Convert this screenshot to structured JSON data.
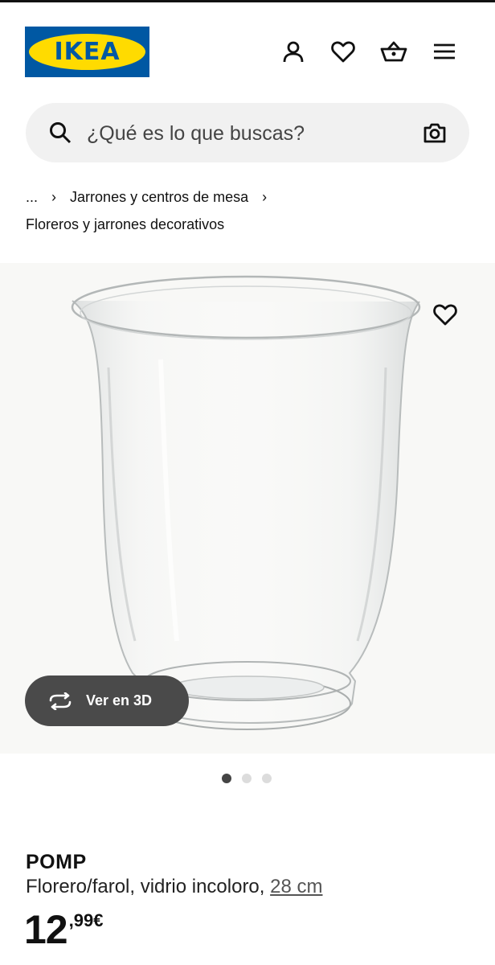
{
  "header": {
    "logo_text": "IKEA",
    "icons": [
      "user-icon",
      "heart-icon",
      "basket-icon",
      "menu-icon"
    ]
  },
  "search": {
    "placeholder": "¿Qué es lo que buscas?",
    "icons": [
      "search-icon",
      "camera-icon"
    ]
  },
  "breadcrumb": {
    "ellipsis": "...",
    "parent": "Jarrones y centros de mesa",
    "current": "Floreros y jarrones decorativos"
  },
  "gallery": {
    "view_3d_label": "Ver en 3D",
    "image_count": 3,
    "active_image": 1
  },
  "product": {
    "name": "POMP",
    "description": "Florero/farol, vidrio incoloro,",
    "size": "28 cm",
    "price_integer": "12",
    "price_decimal": ",99€"
  },
  "colors": {
    "ikea_blue": "#0058a3",
    "ikea_yellow": "#ffdb00",
    "search_bg": "#f1f1f1",
    "button_3d_bg": "#4a4a4a"
  }
}
